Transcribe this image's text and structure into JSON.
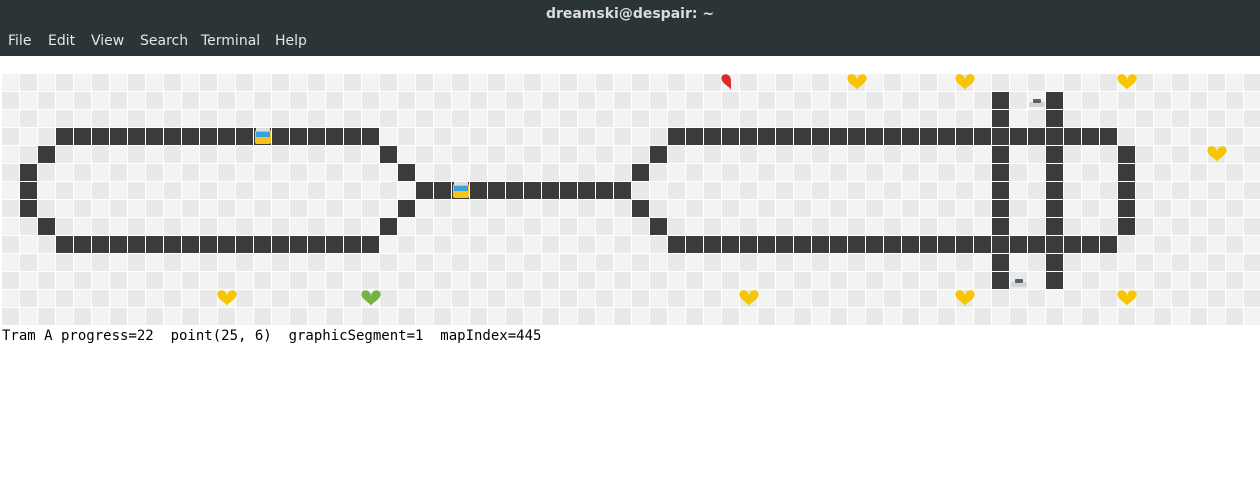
{
  "window": {
    "title": "dreamski@despair: ~"
  },
  "menu": [
    "File",
    "Edit",
    "View",
    "Search",
    "Terminal",
    "Help"
  ],
  "colors": {
    "titlebar_bg": "#2b3437",
    "cell_light": "#e9e9e9",
    "cell_light_alt": "#f3f3f3",
    "track": "#3b3b3b",
    "track_light": "#4a4a4a",
    "heart_yellow": "#f7c600",
    "heart_green": "#77b244",
    "heart_red": "#dd2a2a",
    "tram_yellow": "#f6c21c"
  },
  "map": {
    "rows": 14,
    "cols": 70,
    "icons": [
      {
        "type": "heart-red-half",
        "row": 0,
        "col": 40
      },
      {
        "type": "heart-yellow",
        "row": 0,
        "col": 47
      },
      {
        "type": "heart-yellow",
        "row": 0,
        "col": 53
      },
      {
        "type": "heart-yellow",
        "row": 0,
        "col": 62
      },
      {
        "type": "heart-yellow",
        "row": 4,
        "col": 67
      },
      {
        "type": "tram",
        "row": 3,
        "col": 14
      },
      {
        "type": "tram",
        "row": 6,
        "col": 25
      },
      {
        "type": "car",
        "row": 1,
        "col": 57
      },
      {
        "type": "car",
        "row": 11,
        "col": 56
      },
      {
        "type": "heart-yellow",
        "row": 12,
        "col": 12
      },
      {
        "type": "heart-green",
        "row": 12,
        "col": 20
      },
      {
        "type": "heart-yellow",
        "row": 12,
        "col": 41
      },
      {
        "type": "heart-yellow",
        "row": 12,
        "col": 53
      },
      {
        "type": "heart-yellow",
        "row": 12,
        "col": 62
      }
    ]
  },
  "status_line": "Tram A progress=22  point(25, 6)  graphicSegment=1  mapIndex=445"
}
